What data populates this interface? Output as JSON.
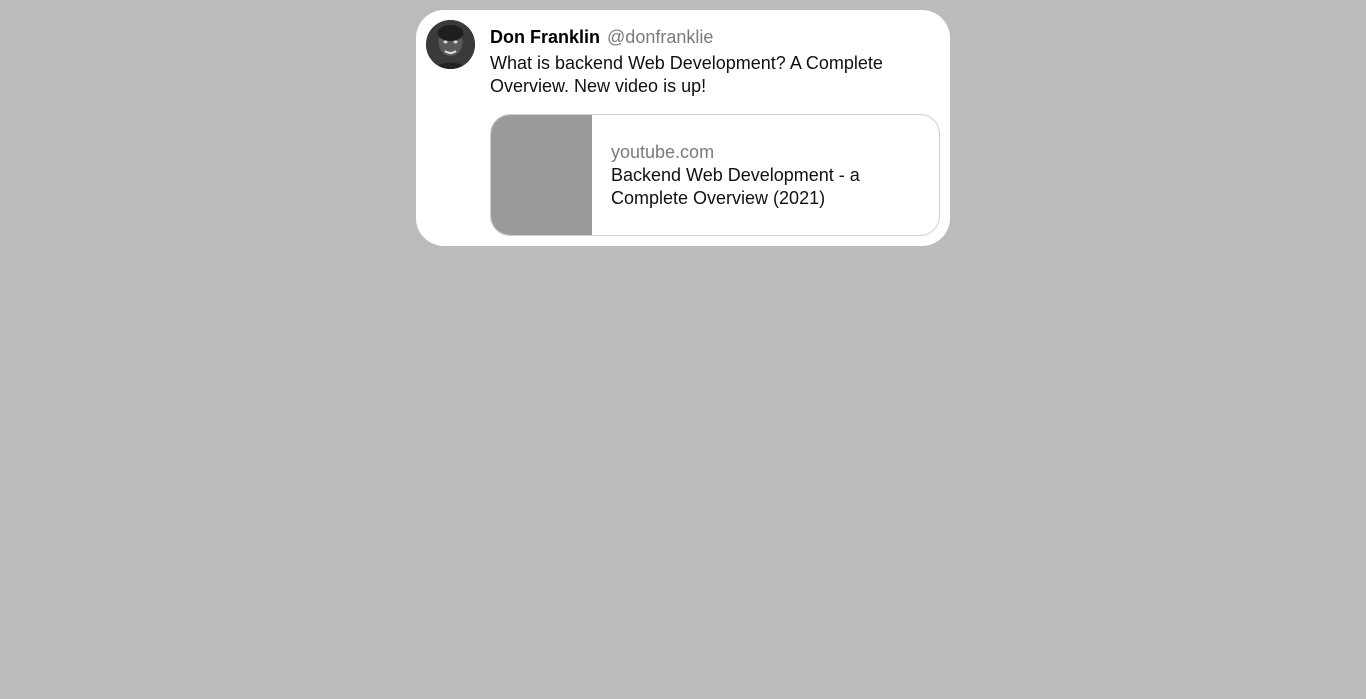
{
  "tweet": {
    "author": {
      "display_name": "Don Franklin",
      "handle": "@donfranklie",
      "avatar_icon": "user-avatar-photo"
    },
    "text": "What is backend Web Development? A Complete Overview. New video is up!",
    "link_preview": {
      "domain": "youtube.com",
      "title": "Backend Web Development - a Complete Overview (2021)",
      "thumbnail_color": "#9a9a9a"
    }
  },
  "colors": {
    "page_background": "#bbbbbb",
    "card_background": "#ffffff",
    "muted_text": "#7a7a7a"
  }
}
